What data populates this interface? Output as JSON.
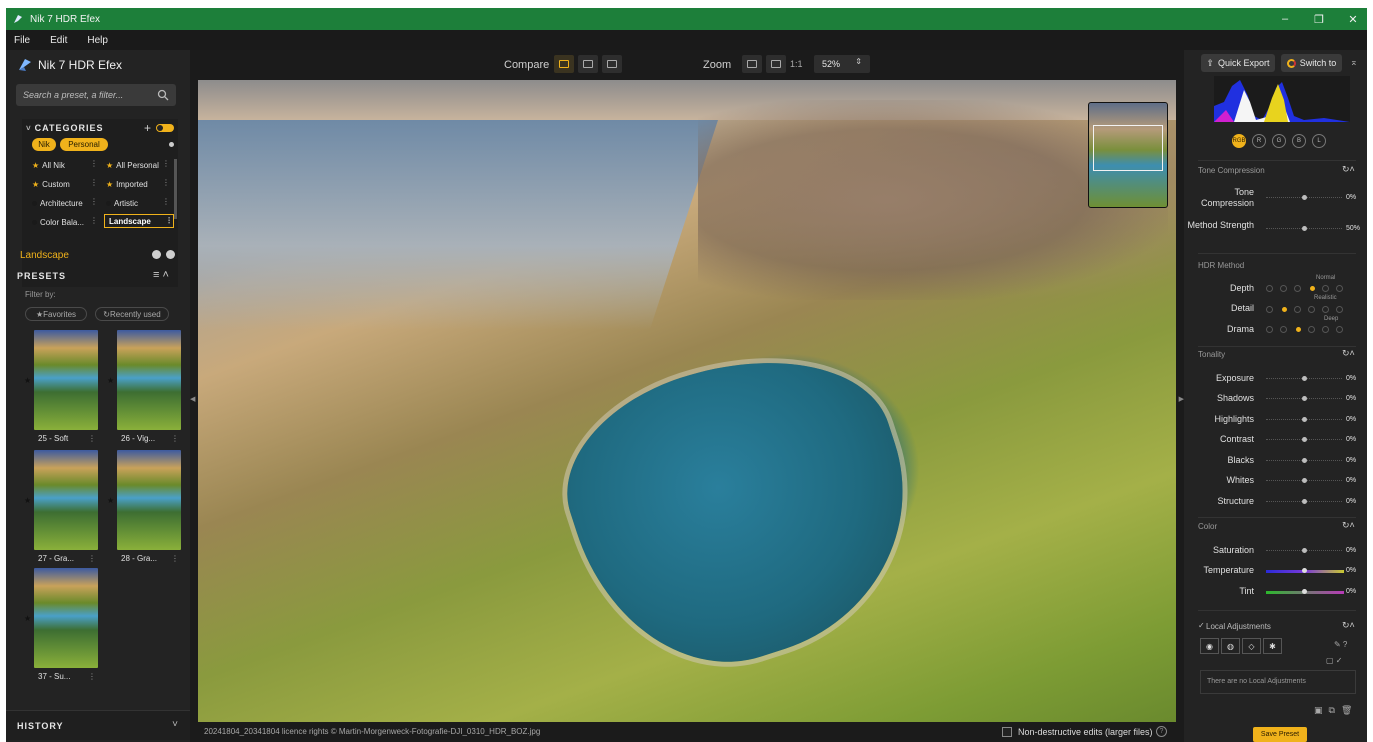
{
  "window": {
    "title": "Nik 7 HDR Efex",
    "controls": [
      "–",
      "❐",
      "✕"
    ]
  },
  "menu": [
    "File",
    "Edit",
    "Help"
  ],
  "left_panel": {
    "brand": "Nik 7 HDR Efex",
    "search_placeholder": "Search a preset, a filter...",
    "categories": {
      "title": "CATEGORIES",
      "tags": [
        "Nik",
        "Personal"
      ],
      "items": [
        {
          "label": "All Nik",
          "starred": true
        },
        {
          "label": "All Personal",
          "starred": true
        },
        {
          "label": "Custom",
          "starred": true
        },
        {
          "label": "Imported",
          "starred": true
        },
        {
          "label": "Architecture",
          "starred": false
        },
        {
          "label": "Artistic",
          "starred": false
        },
        {
          "label": "Color Bala...",
          "starred": false
        },
        {
          "label": "Landscape",
          "starred": false,
          "selected": true
        }
      ]
    },
    "selected_category": "Landscape",
    "presets": {
      "title": "PRESETS",
      "filter_by": "Filter by:",
      "filters": [
        "Favorites",
        "Recently used"
      ],
      "items": [
        "25 - Soft",
        "26 - Vig...",
        "27 - Gra...",
        "28 - Gra...",
        "37 - Su..."
      ]
    },
    "history": "HISTORY"
  },
  "toolbar": {
    "compare_label": "Compare",
    "zoom_label": "Zoom",
    "one_to_one": "1:1",
    "zoom_value": "52%"
  },
  "status": {
    "filename": "20241804_20341804 licence rights © Martin-Morgenweck-Fotografie-DJI_0310_HDR_BOZ.jpg",
    "non_destructive": "Non-destructive edits (larger files)"
  },
  "right_panel": {
    "quick_export": "Quick Export",
    "switch_to": "Switch to",
    "channels": [
      "RGB",
      "R",
      "G",
      "B",
      "L"
    ],
    "tone_compression": {
      "title": "Tone Compression",
      "rows": [
        {
          "label": "Tone Compression",
          "value": "0%",
          "pos": 0.5
        },
        {
          "label": "Method Strength",
          "value": "50%",
          "pos": 0.5
        }
      ]
    },
    "hdr_method": {
      "title": "HDR Method",
      "rows": [
        {
          "label": "Depth",
          "caption": "Normal",
          "level": 4
        },
        {
          "label": "Detail",
          "caption": "Realistic",
          "level": 2
        },
        {
          "label": "Drama",
          "caption": "Deep",
          "level": 3
        }
      ]
    },
    "tonality": {
      "title": "Tonality",
      "rows": [
        {
          "label": "Exposure",
          "value": "0%",
          "pos": 0.5
        },
        {
          "label": "Shadows",
          "value": "0%",
          "pos": 0.5
        },
        {
          "label": "Highlights",
          "value": "0%",
          "pos": 0.5
        },
        {
          "label": "Contrast",
          "value": "0%",
          "pos": 0.5
        },
        {
          "label": "Blacks",
          "value": "0%",
          "pos": 0.5
        },
        {
          "label": "Whites",
          "value": "0%",
          "pos": 0.5
        },
        {
          "label": "Structure",
          "value": "0%",
          "pos": 0.5
        }
      ]
    },
    "color": {
      "title": "Color",
      "rows": [
        {
          "label": "Saturation",
          "value": "0%",
          "pos": 0.5
        },
        {
          "label": "Temperature",
          "value": "0%",
          "pos": 0.5
        },
        {
          "label": "Tint",
          "value": "0%",
          "pos": 0.5
        }
      ]
    },
    "local_adjustments": {
      "title": "Local Adjustments",
      "empty": "There are no Local Adjustments"
    },
    "save_preset": "Save Preset"
  },
  "colors": {
    "accent": "#f0b21b",
    "titlebar": "#1d7f3a",
    "panel": "#232323"
  }
}
